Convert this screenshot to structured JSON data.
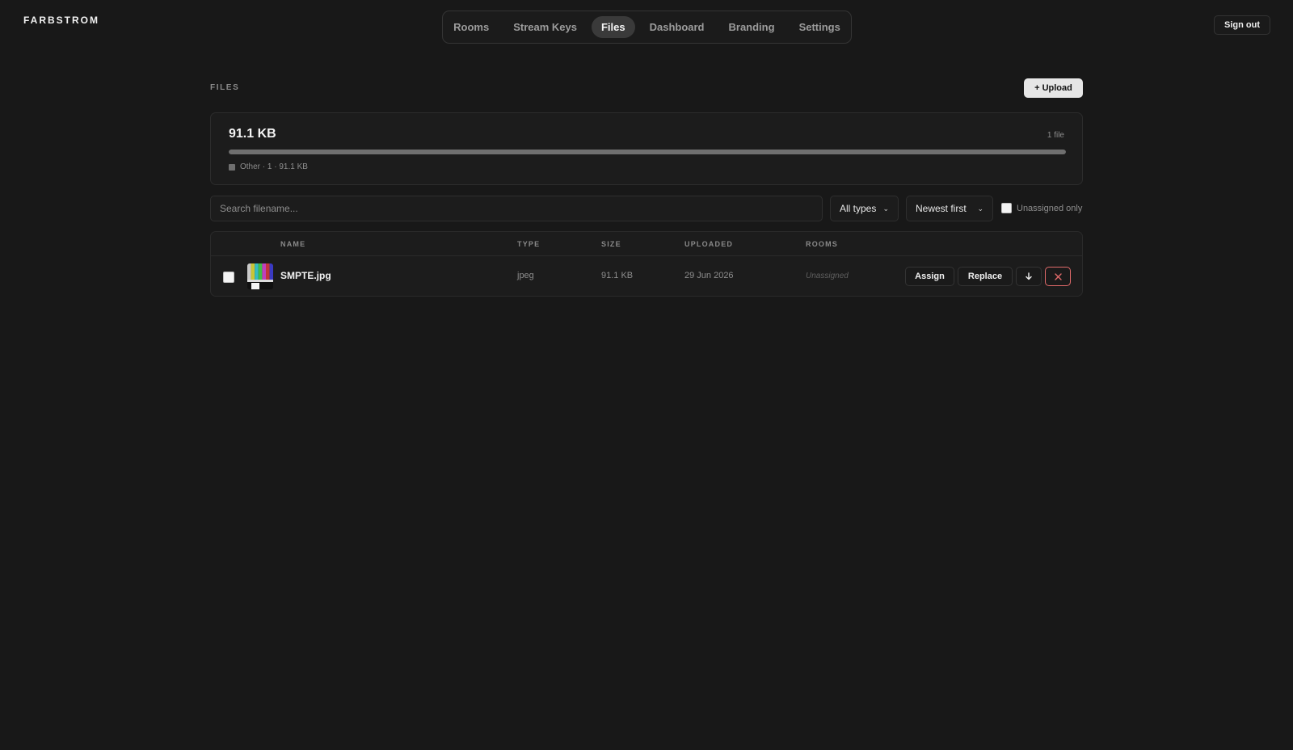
{
  "brand": "FARBSTROM",
  "nav": {
    "items": [
      {
        "label": "Rooms"
      },
      {
        "label": "Stream Keys"
      },
      {
        "label": "Files"
      },
      {
        "label": "Dashboard"
      },
      {
        "label": "Branding"
      },
      {
        "label": "Settings"
      }
    ],
    "active": "Files"
  },
  "sign_out_label": "Sign out",
  "section_label": "FILES",
  "upload_label": "+ Upload",
  "storage": {
    "total": "91.1 KB",
    "file_count": "1 file",
    "used_fraction": 1.0,
    "legend": "Other · 1 · 91.1 KB",
    "legend_color": "#6f6f6f"
  },
  "filters": {
    "search_placeholder": "Search filename...",
    "type_select": "All types",
    "sort_select": "Newest first",
    "unassigned_label": "Unassigned only"
  },
  "table": {
    "columns": [
      "NAME",
      "TYPE",
      "SIZE",
      "UPLOADED",
      "ROOMS"
    ],
    "rows": [
      {
        "name": "SMPTE.jpg",
        "type": "jpeg",
        "size": "91.1 KB",
        "uploaded": "29 Jun 2026",
        "rooms": "Unassigned"
      }
    ],
    "actions": {
      "assign": "Assign",
      "replace": "Replace",
      "download_icon": "download-icon",
      "delete_icon": "close-icon"
    }
  },
  "colors": {
    "background": "#181818",
    "danger": "#e26b6b"
  }
}
